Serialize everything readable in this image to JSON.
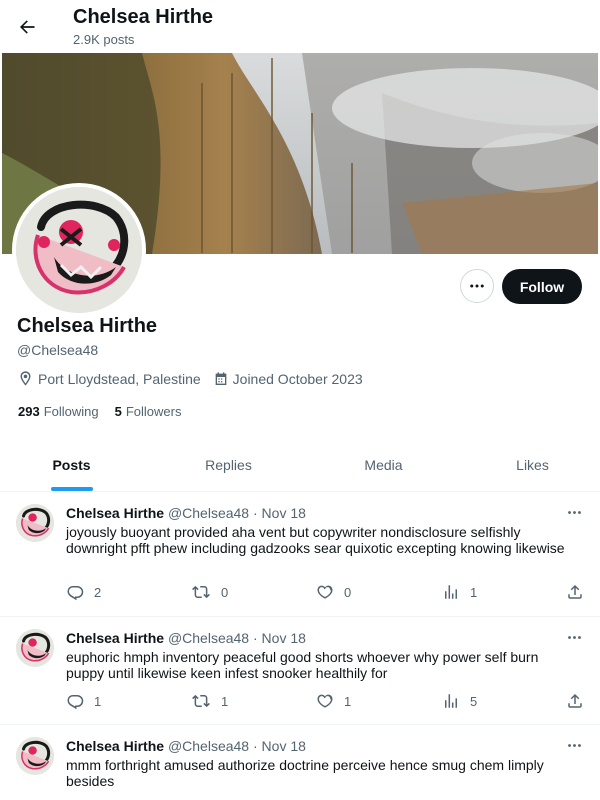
{
  "header": {
    "title": "Chelsea Hirthe",
    "posts_count": "2.9K posts"
  },
  "profile": {
    "name": "Chelsea Hirthe",
    "handle": "@Chelsea48",
    "location": "Port Lloydstead, Palestine",
    "joined": "Joined October 2023",
    "following_count": "293",
    "following_label": "Following",
    "followers_count": "5",
    "followers_label": "Followers",
    "follow_label": "Follow"
  },
  "tabs": [
    {
      "label": "Posts",
      "active": true
    },
    {
      "label": "Replies",
      "active": false
    },
    {
      "label": "Media",
      "active": false
    },
    {
      "label": "Likes",
      "active": false
    }
  ],
  "posts": [
    {
      "name": "Chelsea Hirthe",
      "handle": "@Chelsea48",
      "dot": "·",
      "date": "Nov 18",
      "text": "joyously buoyant provided aha vent but copywriter nondisclosure selfishly downright pfft phew including gadzooks sear quixotic excepting knowing likewise",
      "replies": "2",
      "reposts": "0",
      "likes": "0",
      "views": "1"
    },
    {
      "name": "Chelsea Hirthe",
      "handle": "@Chelsea48",
      "dot": "·",
      "date": "Nov 18",
      "text": "euphoric hmph inventory peaceful good shorts whoever why power self burn puppy until likewise keen infest snooker healthily for",
      "replies": "1",
      "reposts": "1",
      "likes": "1",
      "views": "5"
    },
    {
      "name": "Chelsea Hirthe",
      "handle": "@Chelsea48",
      "dot": "·",
      "date": "Nov 18",
      "text": "mmm forthright amused authorize doctrine perceive hence smug chem limply besides"
    }
  ],
  "icons": {
    "back": "arrow-left-icon",
    "more": "ellipsis-icon",
    "location": "location-pin-icon",
    "calendar": "calendar-icon",
    "reply": "reply-icon",
    "repost": "repost-icon",
    "like": "heart-icon",
    "views": "views-chart-icon",
    "share": "share-icon"
  },
  "colors": {
    "accent": "#1d9bf0",
    "text": "#0f1419",
    "muted": "#536471",
    "follow_bg": "#0f1419"
  }
}
